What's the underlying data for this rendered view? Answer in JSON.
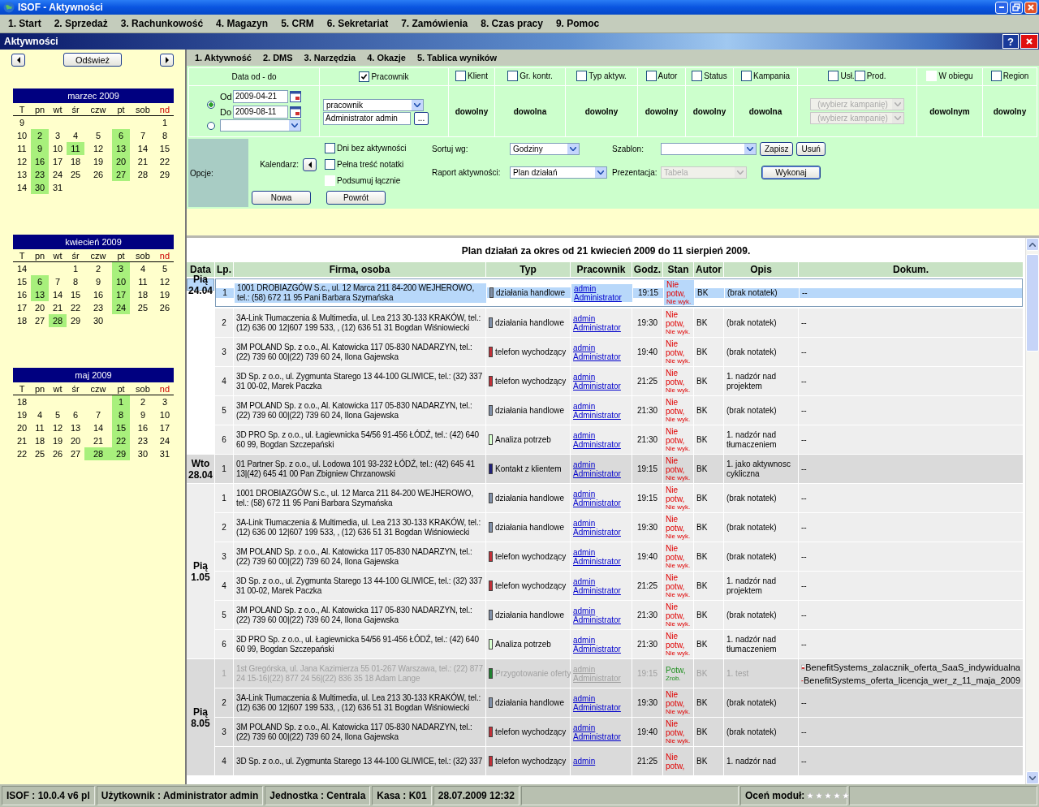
{
  "window": {
    "title": "ISOF - Aktywności"
  },
  "menu": [
    "1. Start",
    "2. Sprzedaż",
    "3. Rachunkowość",
    "4. Magazyn",
    "5. CRM",
    "6. Sekretariat",
    "7. Zamówienia",
    "8. Czas pracy",
    "9. Pomoc"
  ],
  "module": {
    "title": "Aktywności",
    "help": "?"
  },
  "nav": {
    "refresh": "Odśwież"
  },
  "calendars": [
    {
      "title": "marzec 2009",
      "weekdays": [
        {
          "label": "T",
          "kind": "week"
        },
        {
          "label": "pn",
          "kind": "day"
        },
        {
          "label": "wt",
          "kind": "day"
        },
        {
          "label": "śr",
          "kind": "day"
        },
        {
          "label": "czw",
          "kind": "day"
        },
        {
          "label": "pt",
          "kind": "day"
        },
        {
          "label": "sob",
          "kind": "day"
        },
        {
          "label": "nd",
          "kind": "holiday"
        }
      ],
      "weeks": [
        {
          "week": "9",
          "days": {
            "nd": {
              "day": "1",
              "marked": false
            }
          }
        },
        {
          "week": "10",
          "days": {
            "pn": {
              "day": "2",
              "marked": true
            },
            "wt": {
              "day": "3",
              "marked": false
            },
            "sr": {
              "day": "4",
              "marked": false
            },
            "czw": {
              "day": "5",
              "marked": false
            },
            "pt": {
              "day": "6",
              "marked": true
            },
            "sob": {
              "day": "7",
              "marked": false
            },
            "nd": {
              "day": "8",
              "marked": false
            }
          }
        },
        {
          "week": "11",
          "days": {
            "pn": {
              "day": "9",
              "marked": true
            },
            "wt": {
              "day": "10",
              "marked": false
            },
            "sr": {
              "day": "11",
              "marked": true
            },
            "czw": {
              "day": "12",
              "marked": false
            },
            "pt": {
              "day": "13",
              "marked": true
            },
            "sob": {
              "day": "14",
              "marked": false
            },
            "nd": {
              "day": "15",
              "marked": false
            }
          }
        },
        {
          "week": "12",
          "days": {
            "pn": {
              "day": "16",
              "marked": true
            },
            "wt": {
              "day": "17",
              "marked": false
            },
            "sr": {
              "day": "18",
              "marked": false
            },
            "czw": {
              "day": "19",
              "marked": false
            },
            "pt": {
              "day": "20",
              "marked": true
            },
            "sob": {
              "day": "21",
              "marked": false
            },
            "nd": {
              "day": "22",
              "marked": false
            }
          }
        },
        {
          "week": "13",
          "days": {
            "pn": {
              "day": "23",
              "marked": true
            },
            "wt": {
              "day": "24",
              "marked": false
            },
            "sr": {
              "day": "25",
              "marked": false
            },
            "czw": {
              "day": "26",
              "marked": false
            },
            "pt": {
              "day": "27",
              "marked": true
            },
            "sob": {
              "day": "28",
              "marked": false
            },
            "nd": {
              "day": "29",
              "marked": false
            }
          }
        },
        {
          "week": "14",
          "days": {
            "pn": {
              "day": "30",
              "marked": true
            },
            "wt": {
              "day": "31",
              "marked": false
            }
          }
        }
      ]
    },
    {
      "title": "kwiecień 2009",
      "weekdays": [
        {
          "label": "T",
          "kind": "week"
        },
        {
          "label": "pn",
          "kind": "day"
        },
        {
          "label": "wt",
          "kind": "day"
        },
        {
          "label": "śr",
          "kind": "day"
        },
        {
          "label": "czw",
          "kind": "day"
        },
        {
          "label": "pt",
          "kind": "day"
        },
        {
          "label": "sob",
          "kind": "day"
        },
        {
          "label": "nd",
          "kind": "holiday"
        }
      ],
      "weeks": [
        {
          "week": "14",
          "days": {
            "sr": {
              "day": "1",
              "marked": false
            },
            "czw": {
              "day": "2",
              "marked": false
            },
            "pt": {
              "day": "3",
              "marked": true
            },
            "sob": {
              "day": "4",
              "marked": false
            },
            "nd": {
              "day": "5",
              "marked": false
            }
          }
        },
        {
          "week": "15",
          "days": {
            "pn": {
              "day": "6",
              "marked": true
            },
            "wt": {
              "day": "7",
              "marked": false
            },
            "sr": {
              "day": "8",
              "marked": false
            },
            "czw": {
              "day": "9",
              "marked": false
            },
            "pt": {
              "day": "10",
              "marked": true
            },
            "sob": {
              "day": "11",
              "marked": false
            },
            "nd": {
              "day": "12",
              "marked": false
            }
          }
        },
        {
          "week": "16",
          "days": {
            "pn": {
              "day": "13",
              "marked": true
            },
            "wt": {
              "day": "14",
              "marked": false
            },
            "sr": {
              "day": "15",
              "marked": false
            },
            "czw": {
              "day": "16",
              "marked": false
            },
            "pt": {
              "day": "17",
              "marked": true
            },
            "sob": {
              "day": "18",
              "marked": false
            },
            "nd": {
              "day": "19",
              "marked": false
            }
          }
        },
        {
          "week": "17",
          "days": {
            "pn": {
              "day": "20",
              "marked": false
            },
            "wt": {
              "day": "21",
              "marked": false
            },
            "sr": {
              "day": "22",
              "marked": false
            },
            "czw": {
              "day": "23",
              "marked": false
            },
            "pt": {
              "day": "24",
              "marked": true
            },
            "sob": {
              "day": "25",
              "marked": false
            },
            "nd": {
              "day": "26",
              "marked": false
            }
          }
        },
        {
          "week": "18",
          "days": {
            "pn": {
              "day": "27",
              "marked": false
            },
            "wt": {
              "day": "28",
              "marked": true
            },
            "sr": {
              "day": "29",
              "marked": false
            },
            "czw": {
              "day": "30",
              "marked": false
            }
          }
        }
      ]
    },
    {
      "title": "maj 2009",
      "weekdays": [
        {
          "label": "T",
          "kind": "week"
        },
        {
          "label": "pn",
          "kind": "day"
        },
        {
          "label": "wt",
          "kind": "day"
        },
        {
          "label": "śr",
          "kind": "day"
        },
        {
          "label": "czw",
          "kind": "day"
        },
        {
          "label": "pt",
          "kind": "day"
        },
        {
          "label": "sob",
          "kind": "day"
        },
        {
          "label": "nd",
          "kind": "holiday"
        }
      ],
      "weeks": [
        {
          "week": "18",
          "days": {
            "pt": {
              "day": "1",
              "marked": true
            },
            "sob": {
              "day": "2",
              "marked": false
            },
            "nd": {
              "day": "3",
              "marked": false
            }
          }
        },
        {
          "week": "19",
          "days": {
            "pn": {
              "day": "4",
              "marked": false
            },
            "wt": {
              "day": "5",
              "marked": false
            },
            "sr": {
              "day": "6",
              "marked": false
            },
            "czw": {
              "day": "7",
              "marked": false
            },
            "pt": {
              "day": "8",
              "marked": true
            },
            "sob": {
              "day": "9",
              "marked": false
            },
            "nd": {
              "day": "10",
              "marked": false
            }
          }
        },
        {
          "week": "20",
          "days": {
            "pn": {
              "day": "11",
              "marked": false
            },
            "wt": {
              "day": "12",
              "marked": false
            },
            "sr": {
              "day": "13",
              "marked": false
            },
            "czw": {
              "day": "14",
              "marked": false
            },
            "pt": {
              "day": "15",
              "marked": true
            },
            "sob": {
              "day": "16",
              "marked": false
            },
            "nd": {
              "day": "17",
              "marked": false
            }
          }
        },
        {
          "week": "21",
          "days": {
            "pn": {
              "day": "18",
              "marked": false
            },
            "wt": {
              "day": "19",
              "marked": false
            },
            "sr": {
              "day": "20",
              "marked": false
            },
            "czw": {
              "day": "21",
              "marked": false
            },
            "pt": {
              "day": "22",
              "marked": true
            },
            "sob": {
              "day": "23",
              "marked": false
            },
            "nd": {
              "day": "24",
              "marked": false
            }
          }
        },
        {
          "week": "22",
          "days": {
            "pn": {
              "day": "25",
              "marked": false
            },
            "wt": {
              "day": "26",
              "marked": false
            },
            "sr": {
              "day": "27",
              "marked": false
            },
            "czw": {
              "day": "28",
              "marked": true
            },
            "pt": {
              "day": "29",
              "marked": true
            },
            "sob": {
              "day": "30",
              "marked": false
            },
            "nd": {
              "day": "31",
              "marked": false
            }
          }
        }
      ]
    }
  ],
  "tabs": [
    "1. Aktywność",
    "2. DMS",
    "3. Narzędzia",
    "4. Okazje",
    "5. Tablica wyników"
  ],
  "filters": {
    "date": {
      "header": "Data od - do",
      "range_selected": true,
      "from_label": "Od",
      "from": "2009-04-21",
      "to_label": "Do",
      "to": "2009-08-11"
    },
    "employee": {
      "label": "Pracownik",
      "checked": true,
      "select": "pracownik",
      "value": "Administrator admin",
      "browse": "..."
    },
    "columns": [
      {
        "kind": "single",
        "checks": [
          {
            "label": "Klient",
            "checked": false,
            "disabled": false
          }
        ],
        "value": "dowolny"
      },
      {
        "kind": "single",
        "checks": [
          {
            "label": "Gr. kontr.",
            "checked": false,
            "disabled": false
          }
        ],
        "value": "dowolna"
      },
      {
        "kind": "single",
        "checks": [
          {
            "label": "Typ aktyw.",
            "checked": false,
            "disabled": false
          }
        ],
        "value": "dowolny"
      },
      {
        "kind": "single",
        "checks": [
          {
            "label": "Autor",
            "checked": false,
            "disabled": false
          }
        ],
        "value": "dowolny"
      },
      {
        "kind": "single",
        "checks": [
          {
            "label": "Status",
            "checked": false,
            "disabled": false
          }
        ],
        "value": "dowolny"
      },
      {
        "kind": "single",
        "checks": [
          {
            "label": "Kampania",
            "checked": false,
            "disabled": false
          }
        ],
        "value": "dowolna"
      },
      {
        "kind": "pair",
        "checks": [
          {
            "label": "Usł.",
            "checked": false,
            "disabled": false
          },
          {
            "label": "Prod.",
            "checked": false,
            "disabled": false
          }
        ],
        "selects": [
          "(wybierz kampanię)",
          "(wybierz kampanię)"
        ]
      },
      {
        "kind": "single",
        "checks": [
          {
            "label": "W obiegu",
            "checked": false,
            "disabled": true
          }
        ],
        "value": "dowolnym"
      },
      {
        "kind": "single",
        "checks": [
          {
            "label": "Region",
            "checked": false,
            "disabled": false
          }
        ],
        "value": "dowolny"
      }
    ]
  },
  "options": {
    "label": "Opcje:",
    "calendar_label": "Kalendarz:",
    "checks": [
      {
        "label": "Dni bez aktywności",
        "checked": false,
        "disabled": false
      },
      {
        "label": "Pełna treść notatki",
        "checked": false,
        "disabled": false
      },
      {
        "label": "Podsumuj łącznie",
        "checked": false,
        "disabled": true
      }
    ],
    "new_button": "Nowa",
    "back_button": "Powrót",
    "sort_label": "Sortuj wg:",
    "sort": "Godziny",
    "report_label": "Raport aktywności:",
    "report": "Plan działań",
    "template_label": "Szablon:",
    "save_button": "Zapisz",
    "delete_button": "Usuń",
    "presentation_label": "Prezentacja:",
    "presentation": "Tabela",
    "presentation_disabled": true,
    "run_button": "Wykonaj"
  },
  "report": {
    "title": "Plan działań za okres od 21 kwiecień 2009 do 11 sierpień 2009.",
    "columns": [
      "Data",
      "Lp.",
      "Firma, osoba",
      "Typ",
      "Pracownik",
      "Godz.",
      "Stan",
      "Autor",
      "Opis",
      "Dokum."
    ],
    "groups": [
      {
        "day": "Pią",
        "date": "24.04",
        "rows": [
          {
            "lp": "1",
            "firm": "1001 DROBIAZGÓW S.c., ul. 12 Marca 211 84-200 WEJHEROWO, tel.: (58) 672 11 95 Pani Barbara Szymańska",
            "type": "działania handlowe",
            "color": "#8090a8",
            "login": "admin",
            "employee": "Administrator",
            "time": "19:15",
            "status": "Nie potw,",
            "status_sub": "Nie wyk.",
            "confirmed": false,
            "author": "BK",
            "note": "(brak notatek)",
            "docs_text": "--",
            "selected": true,
            "done": false
          },
          {
            "lp": "2",
            "firm": "3A-Link Tłumaczenia & Multimedia, ul. Lea 213 30-133 KRAKÓW, tel.: (12) 636 00 12|607 199 533, , (12) 636 51 31 Bogdan Wiśniowiecki",
            "type": "działania handlowe",
            "color": "#8090a8",
            "login": "admin",
            "employee": "Administrator",
            "time": "19:30",
            "status": "Nie potw,",
            "status_sub": "Nie wyk.",
            "confirmed": false,
            "author": "BK",
            "note": "(brak notatek)",
            "docs_text": "--",
            "selected": false,
            "done": false
          },
          {
            "lp": "3",
            "firm": "3M POLAND Sp. z o.o., Al. Katowicka 117 05-830 NADARZYN, tel.: (22) 739 60 00|(22) 739 60 24, Ilona Gajewska",
            "type": "telefon wychodzący",
            "color": "#c03038",
            "login": "admin",
            "employee": "Administrator",
            "time": "19:40",
            "status": "Nie potw,",
            "status_sub": "Nie wyk.",
            "confirmed": false,
            "author": "BK",
            "note": "(brak notatek)",
            "docs_text": "--",
            "selected": false,
            "done": false
          },
          {
            "lp": "4",
            "firm": "3D Sp. z o.o., ul. Zygmunta Starego 13 44-100 GLIWICE, tel.: (32) 337 31 00-02, Marek Paczka",
            "type": "telefon wychodzący",
            "color": "#c03038",
            "login": "admin",
            "employee": "Administrator",
            "time": "21:25",
            "status": "Nie potw,",
            "status_sub": "Nie wyk.",
            "confirmed": false,
            "author": "BK",
            "note": "1. nadzór nad projektem",
            "docs_text": "--",
            "selected": false,
            "done": false
          },
          {
            "lp": "5",
            "firm": "3M POLAND Sp. z o.o., Al. Katowicka 117 05-830 NADARZYN, tel.: (22) 739 60 00|(22) 739 60 24, Ilona Gajewska",
            "type": "działania handlowe",
            "color": "#8090a8",
            "login": "admin",
            "employee": "Administrator",
            "time": "21:30",
            "status": "Nie potw,",
            "status_sub": "Nie wyk.",
            "confirmed": false,
            "author": "BK",
            "note": "(brak notatek)",
            "docs_text": "--",
            "selected": false,
            "done": false
          },
          {
            "lp": "6",
            "firm": "3D PRO Sp. z o.o., ul. Łagiewnicka 54/56 91-456 ŁÓDŹ, tel.: (42) 640 60 99, Bogdan Szczepański",
            "type": "Analiza potrzeb",
            "color": "#d8ffd0",
            "login": "admin",
            "employee": "Administrator",
            "time": "21:30",
            "status": "Nie potw,",
            "status_sub": "Nie wyk.",
            "confirmed": false,
            "author": "BK",
            "note": "1. nadzór nad tłumaczeniem",
            "docs_text": "--",
            "selected": false,
            "done": false
          }
        ]
      },
      {
        "day": "Wto",
        "date": "28.04",
        "rows": [
          {
            "lp": "1",
            "firm": "01 Partner Sp. z o.o., ul. Lodowa 101 93-232 ŁÓDŹ, tel.: (42) 645 41 13|(42) 645 41 00 Pan Zbigniew Chrzanowski",
            "type": "Kontakt z klientem",
            "color": "#202078",
            "login": "admin",
            "employee": "Administrator",
            "time": "19:15",
            "status": "Nie potw,",
            "status_sub": "Nie wyk.",
            "confirmed": false,
            "author": "BK",
            "note": "1. jako aktywnosc cykliczna",
            "docs_text": "--",
            "selected": false,
            "done": false
          }
        ]
      },
      {
        "day": "Pią",
        "date": "1.05",
        "rows": [
          {
            "lp": "1",
            "firm": "1001 DROBIAZGÓW S.c., ul. 12 Marca 211 84-200 WEJHEROWO, tel.: (58) 672 11 95 Pani Barbara Szymańska",
            "type": "działania handlowe",
            "color": "#8090a8",
            "login": "admin",
            "employee": "Administrator",
            "time": "19:15",
            "status": "Nie potw,",
            "status_sub": "Nie wyk.",
            "confirmed": false,
            "author": "BK",
            "note": "(brak notatek)",
            "docs_text": "--",
            "selected": false,
            "done": false
          },
          {
            "lp": "2",
            "firm": "3A-Link Tłumaczenia & Multimedia, ul. Lea 213 30-133 KRAKÓW, tel.: (12) 636 00 12|607 199 533, , (12) 636 51 31 Bogdan Wiśniowiecki",
            "type": "działania handlowe",
            "color": "#8090a8",
            "login": "admin",
            "employee": "Administrator",
            "time": "19:30",
            "status": "Nie potw,",
            "status_sub": "Nie wyk.",
            "confirmed": false,
            "author": "BK",
            "note": "(brak notatek)",
            "docs_text": "--",
            "selected": false,
            "done": false
          },
          {
            "lp": "3",
            "firm": "3M POLAND Sp. z o.o., Al. Katowicka 117 05-830 NADARZYN, tel.: (22) 739 60 00|(22) 739 60 24, Ilona Gajewska",
            "type": "telefon wychodzący",
            "color": "#c03038",
            "login": "admin",
            "employee": "Administrator",
            "time": "19:40",
            "status": "Nie potw,",
            "status_sub": "Nie wyk.",
            "confirmed": false,
            "author": "BK",
            "note": "(brak notatek)",
            "docs_text": "--",
            "selected": false,
            "done": false
          },
          {
            "lp": "4",
            "firm": "3D Sp. z o.o., ul. Zygmunta Starego 13 44-100 GLIWICE, tel.: (32) 337 31 00-02, Marek Paczka",
            "type": "telefon wychodzący",
            "color": "#c03038",
            "login": "admin",
            "employee": "Administrator",
            "time": "21:25",
            "status": "Nie potw,",
            "status_sub": "Nie wyk.",
            "confirmed": false,
            "author": "BK",
            "note": "1. nadzór nad projektem",
            "docs_text": "--",
            "selected": false,
            "done": false
          },
          {
            "lp": "5",
            "firm": "3M POLAND Sp. z o.o., Al. Katowicka 117 05-830 NADARZYN, tel.: (22) 739 60 00|(22) 739 60 24, Ilona Gajewska",
            "type": "działania handlowe",
            "color": "#8090a8",
            "login": "admin",
            "employee": "Administrator",
            "time": "21:30",
            "status": "Nie potw,",
            "status_sub": "Nie wyk.",
            "confirmed": false,
            "author": "BK",
            "note": "(brak notatek)",
            "docs_text": "--",
            "selected": false,
            "done": false
          },
          {
            "lp": "6",
            "firm": "3D PRO Sp. z o.o., ul. Łagiewnicka 54/56 91-456 ŁÓDŹ, tel.: (42) 640 60 99, Bogdan Szczepański",
            "type": "Analiza potrzeb",
            "color": "#d8ffd0",
            "login": "admin",
            "employee": "Administrator",
            "time": "21:30",
            "status": "Nie potw,",
            "status_sub": "Nie wyk.",
            "confirmed": false,
            "author": "BK",
            "note": "1. nadzór nad tłumaczeniem",
            "docs_text": "--",
            "selected": false,
            "done": false
          }
        ]
      },
      {
        "day": "Pią",
        "date": "8.05",
        "rows": [
          {
            "lp": "1",
            "firm": "1st Gregórska, ul. Jana Kazimierza 55 01-267 Warszawa, tel.: (22) 877 24 15-16|(22) 877 24 56|(22) 836 35 18 Adam Lange",
            "type": "Przygotowanie oferty",
            "color": "#208030",
            "login": "admin",
            "employee": "Administrator",
            "time": "19:15",
            "status": "Potw,",
            "status_sub": "Zrob.",
            "confirmed": true,
            "author": "BK",
            "note": "1. test",
            "docs": [
              "BenefitSystems_zalacznik_oferta_SaaS_indywidualna",
              "BenefitSystems_oferta_licencja_wer_z_11_maja_2009"
            ],
            "selected": false,
            "done": true
          },
          {
            "lp": "2",
            "firm": "3A-Link Tłumaczenia & Multimedia, ul. Lea 213 30-133 KRAKÓW, tel.: (12) 636 00 12|607 199 533, , (12) 636 51 31 Bogdan Wiśniowiecki",
            "type": "działania handlowe",
            "color": "#8090a8",
            "login": "admin",
            "employee": "Administrator",
            "time": "19:30",
            "status": "Nie potw,",
            "status_sub": "Nie wyk.",
            "confirmed": false,
            "author": "BK",
            "note": "(brak notatek)",
            "docs_text": "--",
            "selected": false,
            "done": false
          },
          {
            "lp": "3",
            "firm": "3M POLAND Sp. z o.o., Al. Katowicka 117 05-830 NADARZYN, tel.: (22) 739 60 00|(22) 739 60 24, Ilona Gajewska",
            "type": "telefon wychodzący",
            "color": "#c03038",
            "login": "admin",
            "employee": "Administrator",
            "time": "19:40",
            "status": "Nie potw,",
            "status_sub": "Nie wyk.",
            "confirmed": false,
            "author": "BK",
            "note": "(brak notatek)",
            "docs_text": "--",
            "selected": false,
            "done": false
          },
          {
            "lp": "4",
            "firm": "3D Sp. z o.o., ul. Zygmunta Starego 13 44-100 GLIWICE, tel.: (32) 337",
            "type": "telefon wychodzący",
            "color": "#c03038",
            "login": "admin",
            "time": "21:25",
            "status": "Nie potw,",
            "confirmed": false,
            "author": "BK",
            "note": "1. nadzór nad",
            "docs_text": "--",
            "selected": false,
            "done": false
          }
        ]
      }
    ]
  },
  "status_bar": {
    "items": [
      "ISOF : 10.0.4 v6 pl",
      "Użytkownik : Administrator admin",
      "Jednostka : Centrala",
      "Kasa : K01",
      "28.07.2009 12:32"
    ],
    "rating_label": "Oceń moduł:",
    "stars": 0
  }
}
